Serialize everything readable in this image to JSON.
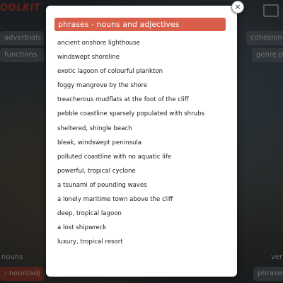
{
  "background": {
    "logo_text": "OOLKIT",
    "chips": {
      "adverbials": "adverbials",
      "cohesion": "cohesion",
      "functions": "functions",
      "genre": "genre p",
      "nouns": "nouns",
      "noun_adj": "- noun/adj",
      "verb": "verb",
      "phrases": "phrases"
    },
    "icons": {
      "image": "image-icon"
    }
  },
  "modal": {
    "close_symbol": "×",
    "title": "phrases - nouns and adjectives",
    "items": [
      "ancient onshore lighthouse",
      "windswept shoreline",
      "exotic lagoon of colourful plankton",
      "foggy mangrove by the shore",
      "treacherous mudflats at the foot of the cliff",
      "pebble coastline sparsely populated with shrubs",
      "sheltered, shingle beach",
      "bleak, windswept peninsula",
      "polluted coastline with no aquatic life",
      "powerful, tropical cyclone",
      "a tsunami of pounding waves",
      "a lonely maritime town above the cliff",
      "deep, tropical lagoon",
      "a lost shipwreck",
      "luxury, tropical resort"
    ]
  },
  "colors": {
    "header": "#d95f4b",
    "overlay": "rgba(0,0,0,0.45)"
  }
}
